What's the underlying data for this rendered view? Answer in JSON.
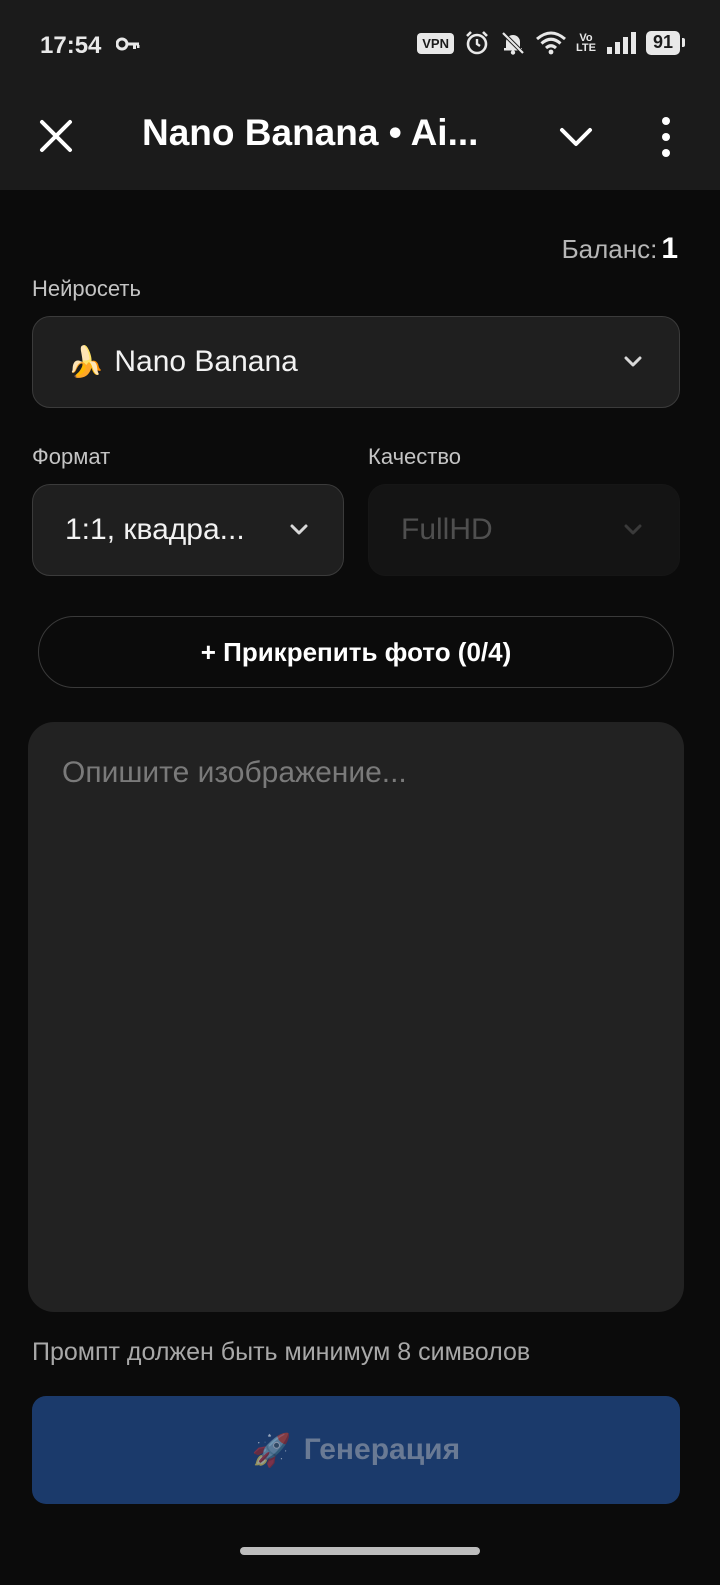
{
  "status_bar": {
    "time": "17:54",
    "vpn": "VPN",
    "volte_top": "Vo",
    "volte_bottom": "LTE",
    "battery": "91",
    "icons": [
      "key-icon",
      "alarm-icon",
      "bell-off-icon",
      "wifi-icon",
      "signal-icon"
    ]
  },
  "header": {
    "title": "Nano Banana • Ai...",
    "close_icon": "close-icon",
    "collapse_icon": "chevron-down-icon",
    "menu_icon": "more-vertical-icon"
  },
  "balance": {
    "label": "Баланс:",
    "value": "1"
  },
  "network": {
    "label": "Нейросеть",
    "emoji": "🍌",
    "value": "Nano Banana"
  },
  "format": {
    "label": "Формат",
    "value": "1:1, квадра..."
  },
  "quality": {
    "label": "Качество",
    "value": "FullHD",
    "disabled": true
  },
  "attach": {
    "label": "+ Прикрепить фото (0/4)"
  },
  "prompt": {
    "value": "",
    "placeholder": "Опишите изображение..."
  },
  "hint": "Промпт должен быть минимум 8 символов",
  "generate": {
    "icon": "🚀",
    "label": "Генерация",
    "color": "#1b3a6b"
  }
}
